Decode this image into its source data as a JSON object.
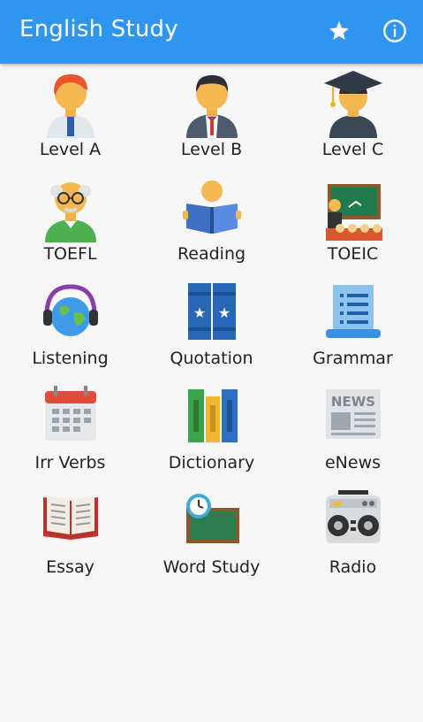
{
  "app": {
    "title": "English Study",
    "actions": [
      {
        "icon": "star-icon"
      },
      {
        "icon": "info-icon"
      }
    ],
    "accent_color": "#2f95ef"
  },
  "menu": [
    {
      "label": "Level A",
      "icon": "student-boy-icon"
    },
    {
      "label": "Level B",
      "icon": "businessman-icon"
    },
    {
      "label": "Level C",
      "icon": "graduate-icon"
    },
    {
      "label": "TOEFL",
      "icon": "professor-icon"
    },
    {
      "label": "Reading",
      "icon": "reading-person-icon"
    },
    {
      "label": "TOEIC",
      "icon": "classroom-icon"
    },
    {
      "label": "Listening",
      "icon": "headphones-globe-icon"
    },
    {
      "label": "Quotation",
      "icon": "quotation-books-icon"
    },
    {
      "label": "Grammar",
      "icon": "grammar-scroll-icon"
    },
    {
      "label": "Irr Verbs",
      "icon": "calendar-icon"
    },
    {
      "label": "Dictionary",
      "icon": "dictionary-books-icon"
    },
    {
      "label": "eNews",
      "icon": "newspaper-icon",
      "icon_text": "NEWS"
    },
    {
      "label": "Essay",
      "icon": "open-book-icon"
    },
    {
      "label": "Word Study",
      "icon": "clock-board-icon"
    },
    {
      "label": "Radio",
      "icon": "radio-icon"
    }
  ]
}
